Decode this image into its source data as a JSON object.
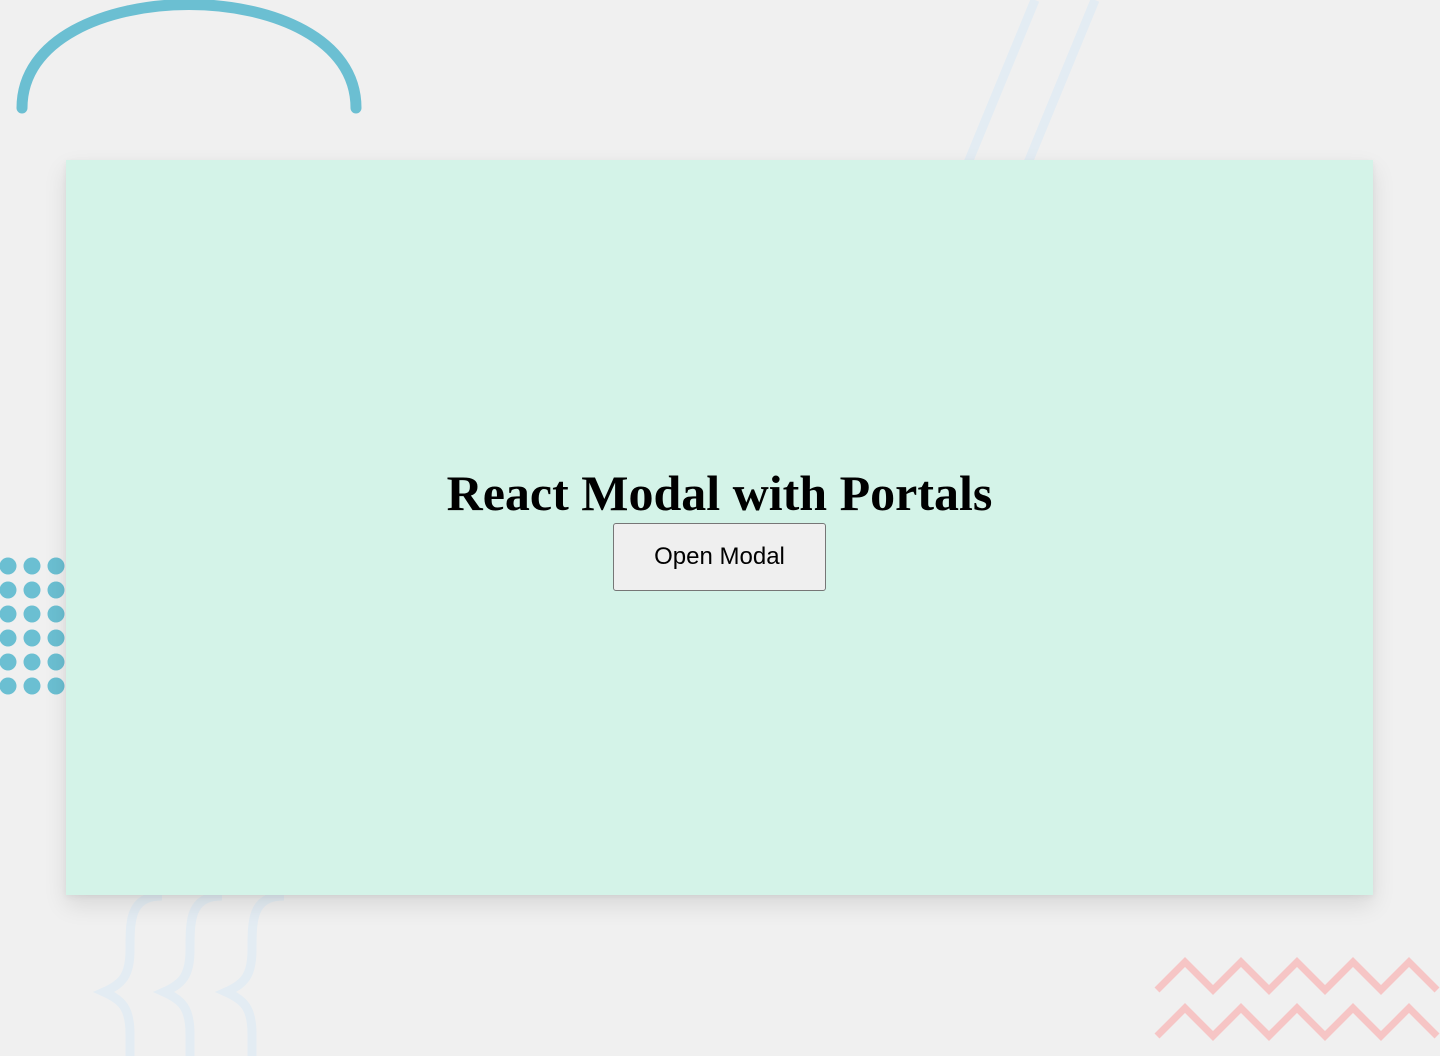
{
  "page": {
    "heading": "React Modal with Portals",
    "open_button_label": "Open Modal"
  },
  "colors": {
    "background": "#f0f0f0",
    "card": "#d4f3e8",
    "accent_blue": "#6bbfd2",
    "faint_blue": "#e3ecf3",
    "pink": "#f6c5c5"
  },
  "decorations": [
    "arc-shape",
    "slash-lines",
    "dot-grid",
    "brace-lines",
    "zigzag-lines"
  ]
}
